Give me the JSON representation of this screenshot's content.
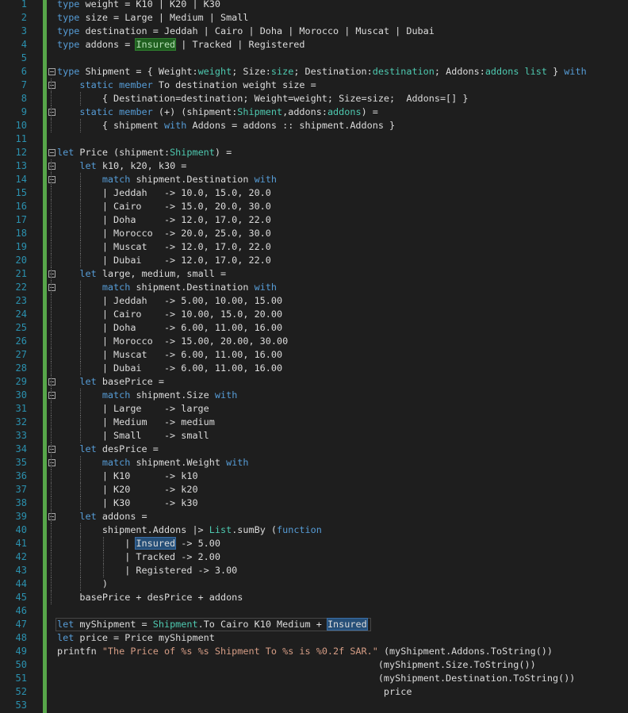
{
  "editor": {
    "lines": [
      [
        [
          "kw",
          "type "
        ],
        [
          "",
          "weight = K10 | K20 | K30"
        ]
      ],
      [
        [
          "kw",
          "type "
        ],
        [
          "",
          "size = Large | Medium | Small"
        ]
      ],
      [
        [
          "kw",
          "type "
        ],
        [
          "",
          "destination = Jeddah | Cairo | Doha | Morocco | Muscat | Dubai"
        ]
      ],
      [
        [
          "kw",
          "type "
        ],
        [
          "",
          "addons = "
        ],
        [
          "hlg",
          "Insured"
        ],
        [
          "",
          " | Tracked | Registered"
        ]
      ],
      [],
      [
        [
          "kw",
          "type "
        ],
        [
          "",
          "Shipment = { Weight:"
        ],
        [
          "ty",
          "weight"
        ],
        [
          "",
          "; Size:"
        ],
        [
          "ty",
          "size"
        ],
        [
          "",
          "; Destination:"
        ],
        [
          "ty",
          "destination"
        ],
        [
          "",
          "; Addons:"
        ],
        [
          "ty",
          "addons list"
        ],
        [
          "",
          " } "
        ],
        [
          "kw",
          "with"
        ]
      ],
      [
        [
          "",
          "    "
        ],
        [
          "kw",
          "static member "
        ],
        [
          "",
          "To destination weight size ="
        ]
      ],
      [
        [
          "",
          "        { Destination=destination; Weight=weight; Size=size;  Addons=[] }"
        ]
      ],
      [
        [
          "",
          "    "
        ],
        [
          "kw",
          "static member "
        ],
        [
          "",
          "(+) (shipment:"
        ],
        [
          "ty",
          "Shipment"
        ],
        [
          "",
          ",addons:"
        ],
        [
          "ty",
          "addons"
        ],
        [
          "",
          ") ="
        ]
      ],
      [
        [
          "",
          "        { shipment "
        ],
        [
          "kw",
          "with "
        ],
        [
          "",
          "Addons = addons :: shipment.Addons }"
        ]
      ],
      [],
      [
        [
          "kw",
          "let "
        ],
        [
          "",
          "Price (shipment:"
        ],
        [
          "ty",
          "Shipment"
        ],
        [
          "",
          ") ="
        ]
      ],
      [
        [
          "",
          "    "
        ],
        [
          "kw",
          "let "
        ],
        [
          "",
          "k10, k20, k30 ="
        ]
      ],
      [
        [
          "",
          "        "
        ],
        [
          "kw",
          "match "
        ],
        [
          "",
          "shipment.Destination "
        ],
        [
          "kw",
          "with"
        ]
      ],
      [
        [
          "",
          "        | Jeddah   -> 10.0, 15.0, 20.0"
        ]
      ],
      [
        [
          "",
          "        | Cairo    -> 15.0, 20.0, 30.0"
        ]
      ],
      [
        [
          "",
          "        | Doha     -> 12.0, 17.0, 22.0"
        ]
      ],
      [
        [
          "",
          "        | Morocco  -> 20.0, 25.0, 30.0"
        ]
      ],
      [
        [
          "",
          "        | Muscat   -> 12.0, 17.0, 22.0"
        ]
      ],
      [
        [
          "",
          "        | Dubai    -> 12.0, 17.0, 22.0"
        ]
      ],
      [
        [
          "",
          "    "
        ],
        [
          "kw",
          "let "
        ],
        [
          "",
          "large, medium, small ="
        ]
      ],
      [
        [
          "",
          "        "
        ],
        [
          "kw",
          "match "
        ],
        [
          "",
          "shipment.Destination "
        ],
        [
          "kw",
          "with"
        ]
      ],
      [
        [
          "",
          "        | Jeddah   -> 5.00, 10.00, 15.00"
        ]
      ],
      [
        [
          "",
          "        | Cairo    -> 10.00, 15.0, 20.00"
        ]
      ],
      [
        [
          "",
          "        | Doha     -> 6.00, 11.00, 16.00"
        ]
      ],
      [
        [
          "",
          "        | Morocco  -> 15.00, 20.00, 30.00"
        ]
      ],
      [
        [
          "",
          "        | Muscat   -> 6.00, 11.00, 16.00"
        ]
      ],
      [
        [
          "",
          "        | Dubai    -> 6.00, 11.00, 16.00"
        ]
      ],
      [
        [
          "",
          "    "
        ],
        [
          "kw",
          "let "
        ],
        [
          "",
          "basePrice ="
        ]
      ],
      [
        [
          "",
          "        "
        ],
        [
          "kw",
          "match "
        ],
        [
          "",
          "shipment.Size "
        ],
        [
          "kw",
          "with"
        ]
      ],
      [
        [
          "",
          "        | Large    -> large"
        ]
      ],
      [
        [
          "",
          "        | Medium   -> medium"
        ]
      ],
      [
        [
          "",
          "        | Small    -> small"
        ]
      ],
      [
        [
          "",
          "    "
        ],
        [
          "kw",
          "let "
        ],
        [
          "",
          "desPrice ="
        ]
      ],
      [
        [
          "",
          "        "
        ],
        [
          "kw",
          "match "
        ],
        [
          "",
          "shipment.Weight "
        ],
        [
          "kw",
          "with"
        ]
      ],
      [
        [
          "",
          "        | K10      -> k10"
        ]
      ],
      [
        [
          "",
          "        | K20      -> k20"
        ]
      ],
      [
        [
          "",
          "        | K30      -> k30"
        ]
      ],
      [
        [
          "",
          "    "
        ],
        [
          "kw",
          "let "
        ],
        [
          "",
          "addons ="
        ]
      ],
      [
        [
          "",
          "        shipment.Addons |> "
        ],
        [
          "ty",
          "List"
        ],
        [
          "",
          ".sumBy ("
        ],
        [
          "kw",
          "function"
        ]
      ],
      [
        [
          "",
          "            | "
        ],
        [
          "hl",
          "Insured"
        ],
        [
          "",
          " -> 5.00"
        ]
      ],
      [
        [
          "",
          "            | Tracked -> 2.00"
        ]
      ],
      [
        [
          "",
          "            | Registered -> 3.00"
        ]
      ],
      [
        [
          "",
          "        )"
        ]
      ],
      [
        [
          "",
          "    basePrice + desPrice + addons"
        ]
      ],
      [],
      [
        [
          "kw",
          "let "
        ],
        [
          "",
          "myShipment = "
        ],
        [
          "ty",
          "Shipment"
        ],
        [
          "",
          ".To Cairo K10 Medium + "
        ],
        [
          "hl",
          "Insured"
        ]
      ],
      [
        [
          "kw",
          "let "
        ],
        [
          "",
          "price = Price myShipment"
        ]
      ],
      [
        [
          "",
          "printfn "
        ],
        [
          "str",
          "\"The Price of %s %s Shipment To %s is %0.2f SAR.\""
        ],
        [
          "",
          " (myShipment.Addons.ToString())"
        ]
      ],
      [
        [
          "",
          "                                                         (myShipment.Size.ToString())"
        ]
      ],
      [
        [
          "",
          "                                                         (myShipment.Destination.ToString())"
        ]
      ],
      [
        [
          "",
          "                                                          price"
        ]
      ],
      []
    ]
  }
}
